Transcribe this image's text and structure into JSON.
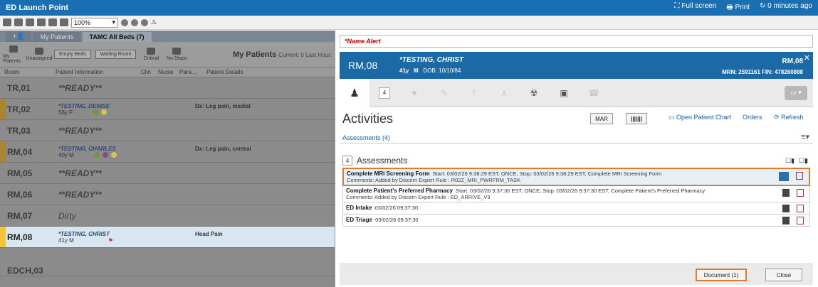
{
  "titlebar": {
    "title": "ED Launch Point",
    "full_screen": "Full screen",
    "print": "Print",
    "refresh_time": "0 minutes ago"
  },
  "toolbar": {
    "zoom": "100%"
  },
  "left": {
    "tabs": [
      "My Patients",
      "TAMC All Beds (7)"
    ],
    "tools": [
      "My Patients",
      "Unassigned",
      "Empty Beds",
      "Waiting Room",
      "Critical",
      "No Dispo"
    ],
    "my_patients_label": "My Patients",
    "current_label": "Current: 0  Last Hour:",
    "columns": [
      "Room",
      "Patient Information",
      "Clin",
      "Nurse",
      "Para...",
      "Patient Details"
    ],
    "rows": [
      {
        "room": "TR,01",
        "name": "**READY**",
        "age": "",
        "details": ""
      },
      {
        "room": "TR,02",
        "name": "*TESTING, DENISE",
        "age": "56y F",
        "details": "Dx: Leg pain, medial"
      },
      {
        "room": "TR,03",
        "name": "**READY**",
        "age": "",
        "details": ""
      },
      {
        "room": "RM,04",
        "name": "*TESTING, CHARLES",
        "age": "40y M",
        "details": "Dx: Leg pain, central"
      },
      {
        "room": "RM,05",
        "name": "**READY**",
        "age": "",
        "details": ""
      },
      {
        "room": "RM,06",
        "name": "**READY**",
        "age": "",
        "details": ""
      },
      {
        "room": "RM,07",
        "name": "Dirty",
        "age": "",
        "details": ""
      },
      {
        "room": "RM,08",
        "name": "*TESTING, CHRIST",
        "age": "41y M",
        "details": "Head Pain"
      }
    ],
    "bottom_room": "EDCH,03"
  },
  "right": {
    "name_alert": "*Name Alert",
    "banner": {
      "location": "RM,08",
      "name": "*TESTING, CHRIST",
      "age": "41y",
      "sex": "M",
      "dob": "DOB: 10/10/84",
      "right_location": "RM,08",
      "mrn": "MRN: 2591161  FIN: 478260888"
    },
    "count_badge": "4",
    "activities_title": "Activities",
    "mar": "MAR",
    "open_chart": "Open Patient Chart",
    "orders": "Orders",
    "refresh": "Refresh",
    "assessments_link": "Assessments (4)",
    "assessments_count": "4",
    "assessments_title": "Assessments",
    "tasks": [
      {
        "name": "Complete MRI Screening Form",
        "detail": "Start: 03/02/26 9:38:29 EST, ONCE, Stop: 03/02/26 9:38:29 EST, Complete MRI Screening Form",
        "comments": "Comments: Added by Discern Expert Rule : R02Z_MRI_PWRFRM_TASK"
      },
      {
        "name": "Complete Patient's Preferred Pharmacy",
        "detail": "Start: 03/02/26 9:37:30 EST, ONCE, Stop: 03/02/26 9:37:30 EST, Complete Patient's Preferred Pharmacy",
        "comments": "Comments: Added by Discern Expert Rule : ED_ARRIVE_V3"
      },
      {
        "name": "ED Intake",
        "detail": "03/02/26 09:37:30",
        "comments": ""
      },
      {
        "name": "ED Triage",
        "detail": "03/02/26 09:37:30",
        "comments": ""
      }
    ],
    "document_btn": "Document (1)",
    "close_btn": "Close"
  }
}
